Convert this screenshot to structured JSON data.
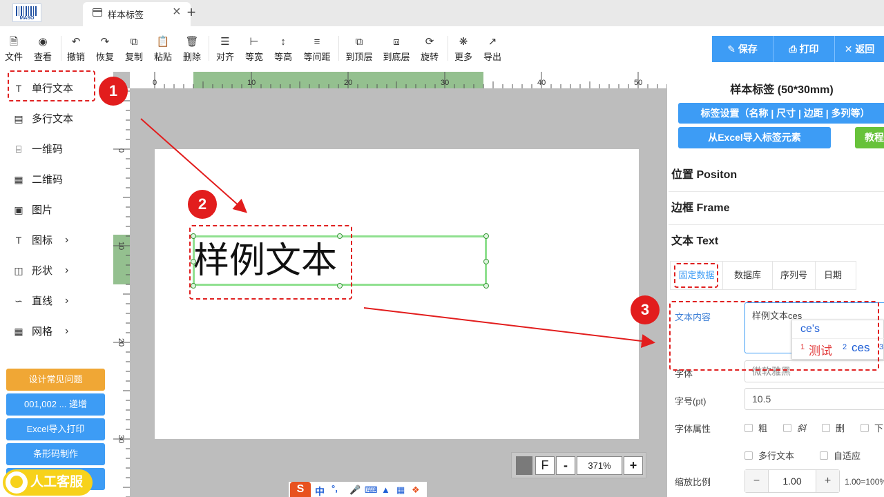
{
  "tabbar": {
    "logo_text": "MASO",
    "tab_title": "样本标签",
    "close_icon": "×",
    "new_tab_icon": "+"
  },
  "toolbar": {
    "items": [
      {
        "label": "文件",
        "icon": "file-icon"
      },
      {
        "label": "查看",
        "icon": "eye-icon"
      },
      {
        "label": "撤销",
        "icon": "undo-icon"
      },
      {
        "label": "恢复",
        "icon": "redo-icon"
      },
      {
        "label": "复制",
        "icon": "copy-icon"
      },
      {
        "label": "粘贴",
        "icon": "paste-icon"
      },
      {
        "label": "删除",
        "icon": "trash-icon"
      },
      {
        "label": "对齐",
        "icon": "align-icon"
      },
      {
        "label": "等宽",
        "icon": "equal-width-icon"
      },
      {
        "label": "等高",
        "icon": "equal-height-icon"
      },
      {
        "label": "等间距",
        "icon": "equal-spacing-icon"
      },
      {
        "label": "到顶层",
        "icon": "bring-to-front-icon"
      },
      {
        "label": "到底层",
        "icon": "send-to-back-icon"
      },
      {
        "label": "旋转",
        "icon": "rotate-icon"
      },
      {
        "label": "更多",
        "icon": "more-icon"
      },
      {
        "label": "导出",
        "icon": "export-icon"
      }
    ],
    "save_label": "保存",
    "print_label": "打印",
    "back_label": "返回"
  },
  "sidebar": {
    "items": [
      {
        "label": "单行文本",
        "icon": "text-icon"
      },
      {
        "label": "多行文本",
        "icon": "multiline-text-icon"
      },
      {
        "label": "一维码",
        "icon": "barcode-icon"
      },
      {
        "label": "二维码",
        "icon": "qrcode-icon"
      },
      {
        "label": "图片",
        "icon": "image-icon"
      },
      {
        "label": "图标",
        "icon": "text-icon"
      },
      {
        "label": "形状",
        "icon": "shape-icon"
      },
      {
        "label": "直线",
        "icon": "line-icon"
      },
      {
        "label": "网格",
        "icon": "grid-icon"
      }
    ],
    "buttons": [
      {
        "label": "设计常见问题",
        "color": "#f0a735"
      },
      {
        "label": "001,002 ... 递增",
        "color": "#3d9cf5"
      },
      {
        "label": "Excel导入打印",
        "color": "#3d9cf5"
      },
      {
        "label": "条形码制作",
        "color": "#3d9cf5"
      }
    ],
    "service_label": "人工客服"
  },
  "canvas": {
    "ruler_top_labels": [
      "0",
      "10",
      "20",
      "30",
      "40",
      "50"
    ],
    "ruler_left_labels": [
      "0",
      "10",
      "20",
      "30"
    ],
    "sample_text": "样例文本",
    "zoom": {
      "fit_label": "F",
      "minus_label": "-",
      "value": "371%",
      "plus_label": "+"
    }
  },
  "annotations": {
    "m1": "1",
    "m2": "2",
    "m3": "3"
  },
  "right": {
    "title": "样本标签 (50*30mm)",
    "settings_btn": "标签设置（名称 | 尺寸 | 边距 | 多列等）",
    "excel_btn": "从Excel导入标签元素",
    "tutorial_btn": "教程",
    "sec_position": "位置 Positon",
    "sec_frame": "边框 Frame",
    "sec_text": "文本 Text",
    "sub_tabs": [
      "固定数据",
      "数据库",
      "序列号",
      "日期"
    ],
    "content_label": "文本内容",
    "content_value": "样例文本ces",
    "ime": {
      "composition": "ce's",
      "cand1_num": "1",
      "cand1": "测试",
      "cand2_num": "2",
      "cand2": "ces",
      "cand3_num": "3"
    },
    "font_label": "字体",
    "font_value": "微软雅黑",
    "size_label": "字号(pt)",
    "size_value": "10.5",
    "attr_label": "字体属性",
    "attrs": [
      "粗",
      "斜",
      "删",
      "下"
    ],
    "multiline_label": "多行文本",
    "autofit_label": "自适应",
    "scale_label": "缩放比例",
    "scale_minus": "−",
    "scale_value": "1.00",
    "scale_plus": "+",
    "scale_note": "1.00=100%"
  },
  "ime_bar": {
    "logo": "S",
    "mode": "中",
    "punct": "°,",
    "icons": [
      "mic-icon",
      "keyboard-icon",
      "shirt-icon",
      "apps-icon",
      "tools-icon"
    ]
  },
  "colors": {
    "accent": "#3d9cf5",
    "orange": "#f0a735",
    "green_btn": "#67c23a",
    "annotation_red": "#e21d1d",
    "selection_green": "#8fe08f",
    "ruler_highlight": "#94c08f"
  }
}
